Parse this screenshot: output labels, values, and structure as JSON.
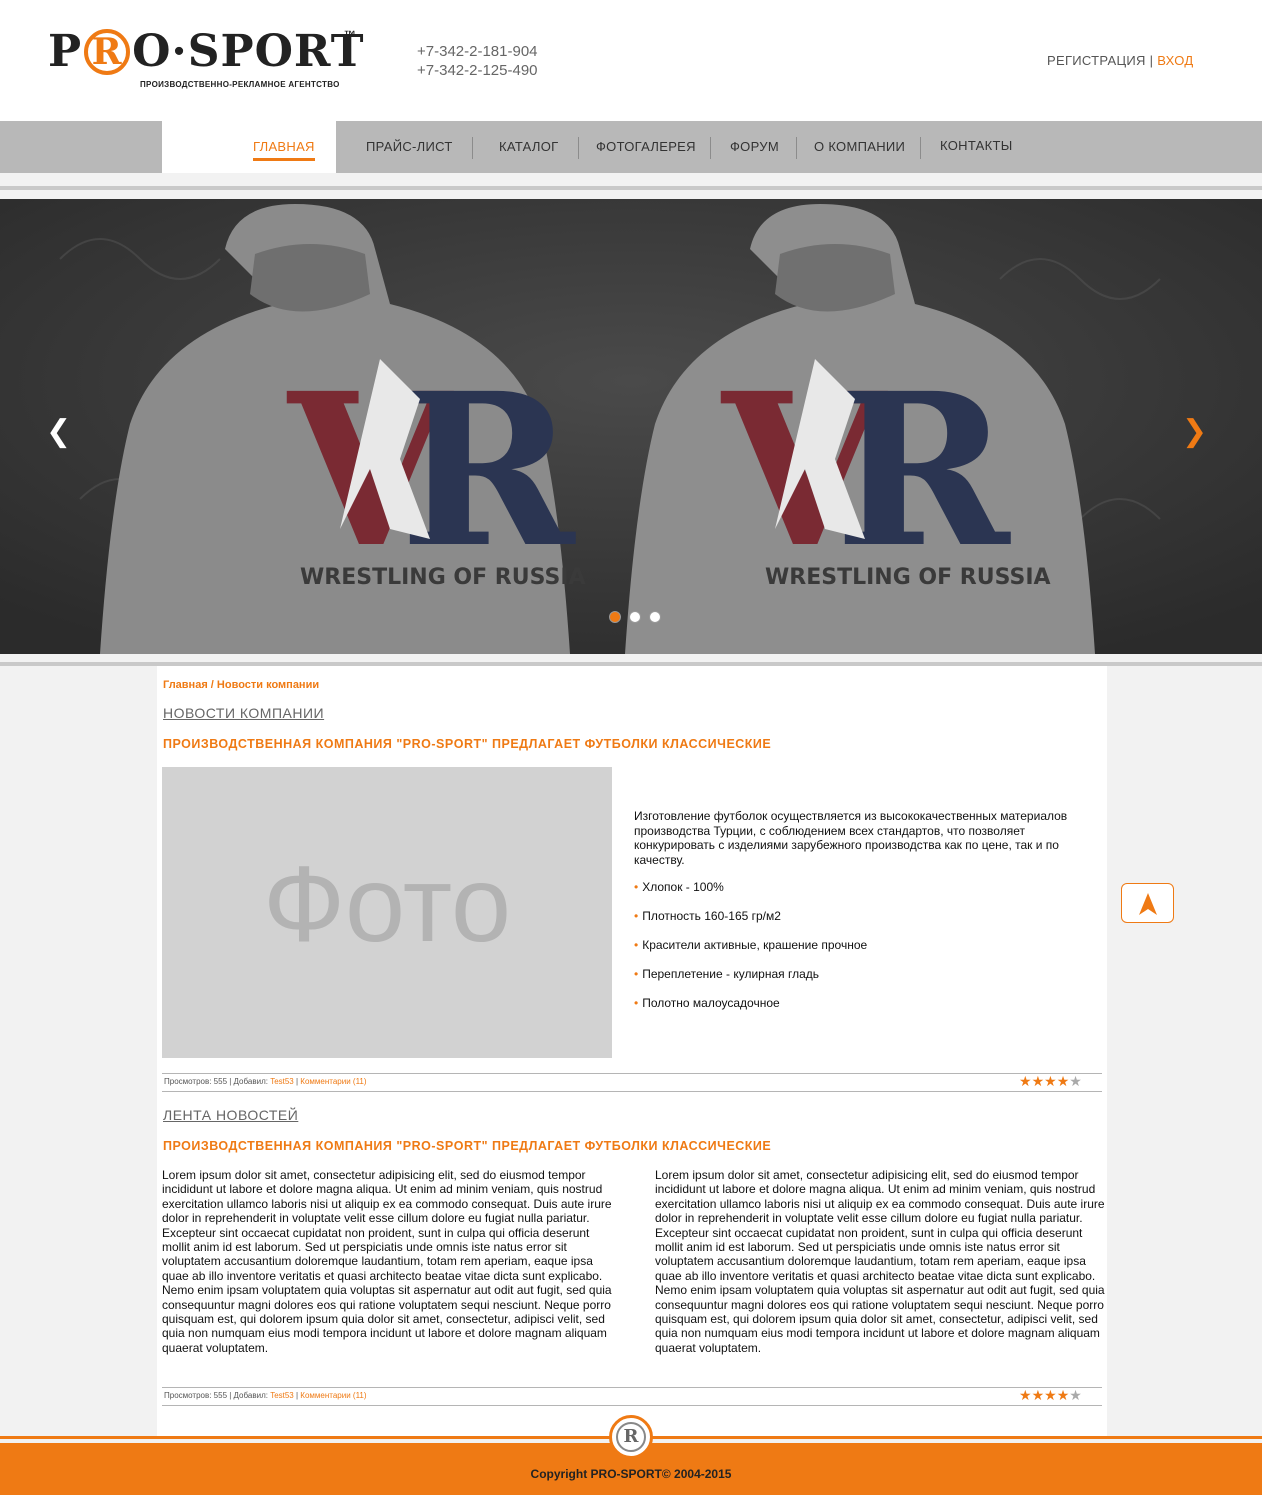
{
  "header": {
    "logo": {
      "left": "P",
      "r": "R",
      "right": "O·SPORT",
      "tm": "™",
      "subtitle": "ПРОИЗВОДСТВЕННО-РЕКЛАМНОЕ АГЕНТСТВО"
    },
    "phones": [
      "+7-342-2-181-904",
      "+7-342-2-125-490"
    ],
    "register_label": "РЕГИСТРАЦИЯ",
    "separator": "|",
    "login_label": "ВХОД"
  },
  "nav": {
    "items": [
      {
        "label": "ГЛАВНАЯ",
        "active": true
      },
      {
        "label": "ПРАЙС-ЛИСТ"
      },
      {
        "label": "КАТАЛОГ"
      },
      {
        "label": "ФОТОГАЛЕРЕЯ"
      },
      {
        "label": "ФОРУМ"
      },
      {
        "label": "О КОМПАНИИ"
      },
      {
        "label": "КОНТАКТЫ"
      }
    ]
  },
  "slider": {
    "prev_icon": "❮",
    "next_icon": "❯",
    "caption": "WRESTLING OF RUSSIA",
    "slide_count": 3,
    "active_slide": 1
  },
  "breadcrumb": {
    "home": "Главная",
    "separator": " / ",
    "current": "Новости компании"
  },
  "news": {
    "section_title": "НОВОСТИ КОМПАНИИ",
    "article_title": "ПРОИЗВОДСТВЕННАЯ КОМПАНИЯ \"PRO-SPORT\" ПРЕДЛАГАЕТ ФУТБОЛКИ КЛАССИЧЕСКИЕ",
    "photo_label": "Фото",
    "intro": "Изготовление футболок осуществляется из высококачественных материалов производства Турции, с соблюдением всех стандартов, что позволяет конкурировать с изделиями зарубежного производства как по цене, так и по качеству.",
    "bullet": "•",
    "features": [
      "Хлопок - 100%",
      "Плотность 160-165 гр/м2",
      "Красители активные, крашение прочное",
      "Переплетение - кулирная гладь",
      "Полотно малоусадочное"
    ],
    "meta": {
      "views": "Просмотров: 555 | Добавил: ",
      "author": "Test53",
      "sep": " | ",
      "comments": "Комментарии (11)"
    },
    "rating": 4
  },
  "feed": {
    "section_title": "ЛЕНТА НОВОСТЕЙ",
    "article_title": "ПРОИЗВОДСТВЕННАЯ КОМПАНИЯ \"PRO-SPORT\" ПРЕДЛАГАЕТ ФУТБОЛКИ КЛАССИЧЕСКИЕ",
    "column_left": "Lorem ipsum dolor sit amet, consectetur adipisicing elit, sed do eiusmod tempor incididunt ut labore et dolore magna aliqua. Ut enim ad minim veniam, quis nostrud exercitation ullamco laboris nisi ut aliquip ex ea commodo consequat. Duis aute irure dolor in reprehenderit in voluptate velit esse cillum dolore eu fugiat nulla pariatur. Excepteur sint occaecat cupidatat non proident, sunt in culpa qui officia deserunt mollit anim id est laborum. Sed ut perspiciatis unde omnis iste natus error sit voluptatem accusantium doloremque laudantium, totam rem aperiam, eaque ipsa quae ab illo inventore veritatis et quasi architecto beatae vitae dicta sunt explicabo. Nemo enim ipsam voluptatem quia voluptas sit aspernatur aut odit aut fugit, sed quia consequuntur magni dolores eos qui ratione voluptatem sequi nesciunt. Neque porro quisquam est, qui dolorem ipsum quia dolor sit amet, consectetur, adipisci velit, sed quia non numquam eius modi tempora incidunt ut labore et dolore magnam aliquam quaerat voluptatem.",
    "column_right": "Lorem ipsum dolor sit amet, consectetur adipisicing elit, sed do eiusmod tempor incididunt ut labore et dolore magna aliqua. Ut enim ad minim veniam, quis nostrud exercitation ullamco laboris nisi ut aliquip ex ea commodo consequat. Duis aute irure dolor in reprehenderit in voluptate velit esse cillum dolore eu fugiat nulla pariatur. Excepteur sint occaecat cupidatat non proident, sunt in culpa qui officia deserunt mollit anim id est laborum. Sed ut perspiciatis unde omnis iste natus error sit voluptatem accusantium doloremque laudantium, totam rem aperiam, eaque ipsa quae ab illo inventore veritatis et quasi architecto beatae vitae dicta sunt explicabo. Nemo enim ipsam voluptatem quia voluptas sit aspernatur aut odit aut fugit, sed quia consequuntur magni dolores eos qui ratione voluptatem sequi nesciunt. Neque porro quisquam est, qui dolorem ipsum quia dolor sit amet, consectetur, adipisci velit, sed quia non numquam eius modi tempora incidunt ut labore et dolore magnam aliquam quaerat voluptatem.",
    "meta": {
      "views": "Просмотров: 555 | Добавил: ",
      "author": "Test53",
      "sep": " | ",
      "comments": "Комментарии (11)"
    },
    "rating": 4
  },
  "footer": {
    "copyright": "Copyright PRO-SPORT© 2004-2015",
    "logo_letter": "R"
  },
  "icons": {
    "scroll_top": "arrow-up-icon",
    "star": "star-icon"
  },
  "colors": {
    "accent": "#ef7a14",
    "nav_bg": "#b8b8b8",
    "photo_placeholder": "#d2d2d2"
  }
}
